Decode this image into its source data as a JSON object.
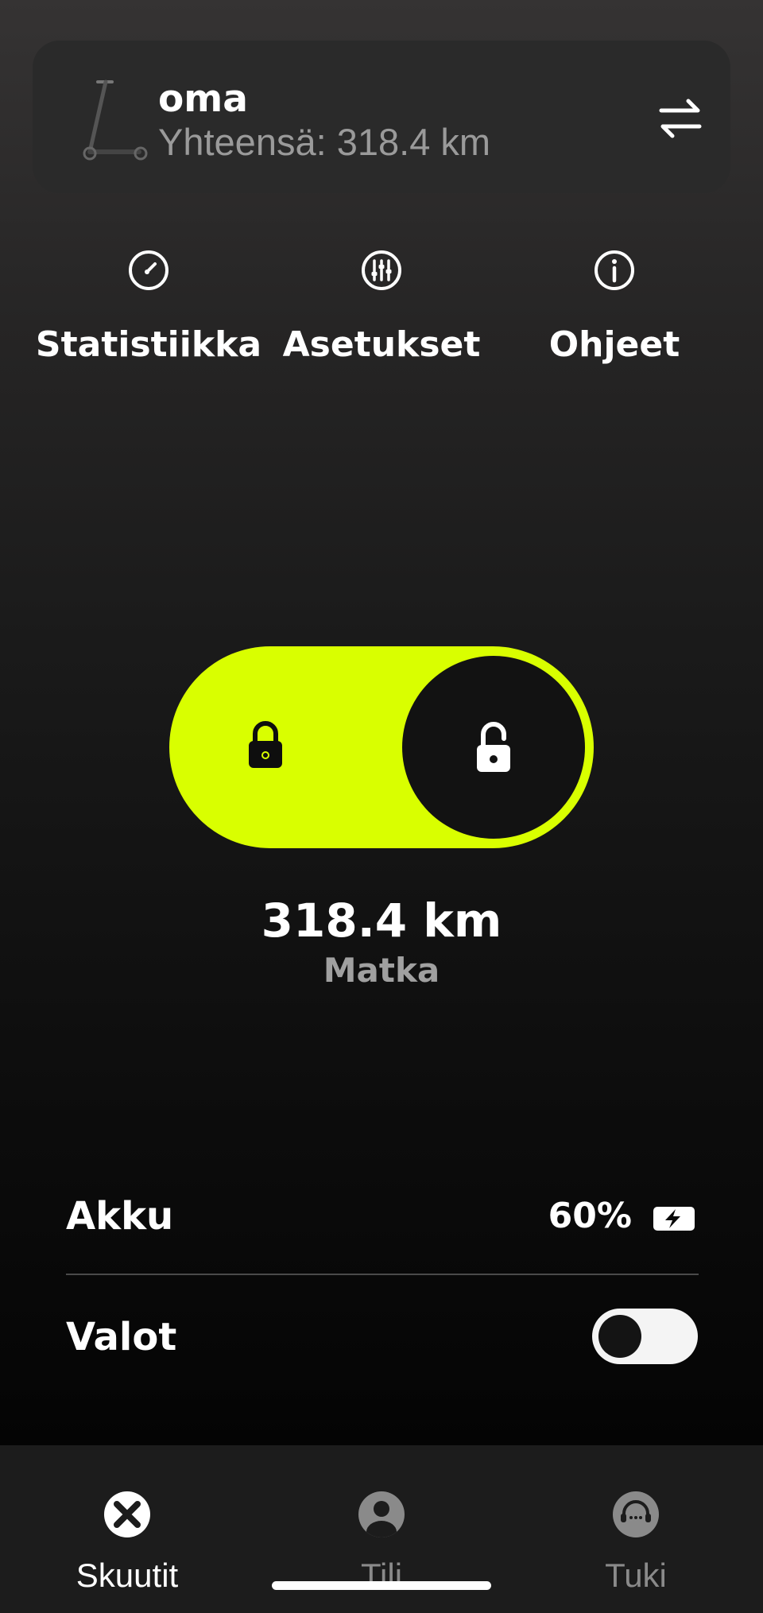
{
  "device": {
    "name": "oma",
    "total": "Yhteensä: 318.4 km"
  },
  "actions": [
    {
      "label": "Statistiikka",
      "icon": "speedometer-icon"
    },
    {
      "label": "Asetukset",
      "icon": "sliders-icon"
    },
    {
      "label": "Ohjeet",
      "icon": "info-icon"
    }
  ],
  "lock": {
    "state": "unlocked",
    "accent_color": "#d9ff00"
  },
  "trip": {
    "value": "318.4 km",
    "label": "Matka"
  },
  "battery": {
    "label": "Akku",
    "value": "60%",
    "level": 0.6,
    "charging_icon": "battery-charging-icon"
  },
  "lights": {
    "label": "Valot",
    "enabled": false
  },
  "nav": {
    "items": [
      {
        "label": "Skuutit",
        "icon": "scooter-wheel-icon",
        "active": true
      },
      {
        "label": "Tili",
        "icon": "account-icon",
        "active": false
      },
      {
        "label": "Tuki",
        "icon": "support-headset-icon",
        "active": false
      }
    ],
    "active_color": "#ffffff",
    "inactive_color": "#8a8a8a"
  }
}
